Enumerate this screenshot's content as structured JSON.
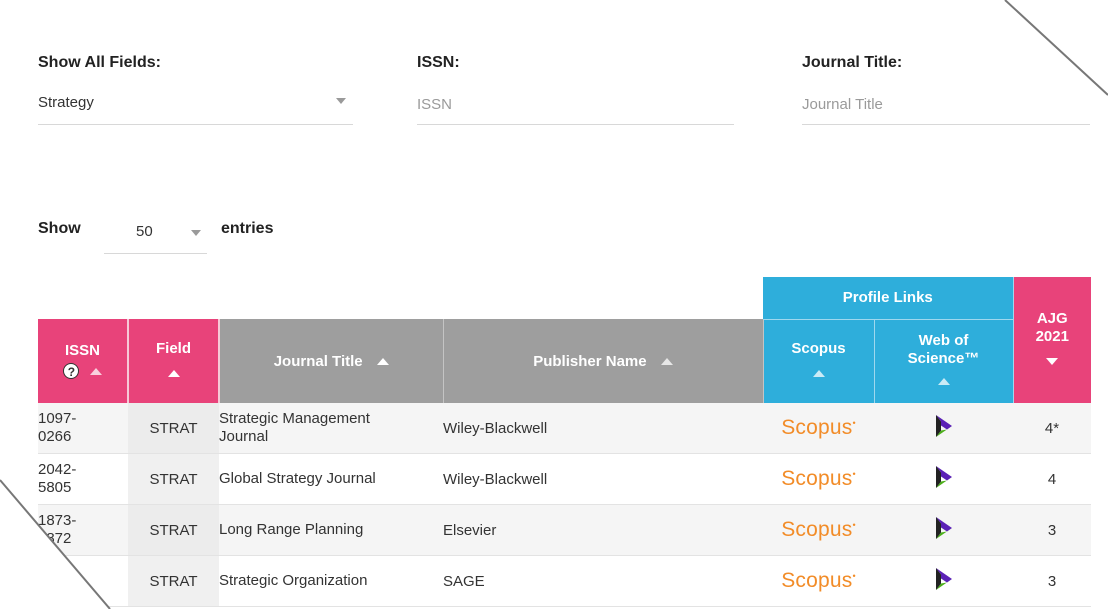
{
  "filters": {
    "field": {
      "label": "Show All Fields:",
      "value": "Strategy"
    },
    "issn": {
      "label": "ISSN:",
      "placeholder": "ISSN"
    },
    "title": {
      "label": "Journal Title:",
      "placeholder": "Journal Title"
    }
  },
  "entries": {
    "show_label": "Show",
    "value": "50",
    "suffix": "entries"
  },
  "table": {
    "group_header": "Profile Links",
    "columns": {
      "issn": "ISSN",
      "field": "Field",
      "title": "Journal Title",
      "publisher": "Publisher Name",
      "scopus": "Scopus",
      "wos_line1": "Web of",
      "wos_line2": "Science™",
      "ajg_line1": "AJG",
      "ajg_line2": "2021"
    },
    "help_symbol": "?",
    "scopus_logo_text": "Scopus",
    "rows": [
      {
        "issn_a": "1097-",
        "issn_b": "0266",
        "field": "STRAT",
        "title_a": "Strategic Management",
        "title_b": "Journal",
        "publisher": "Wiley-Blackwell",
        "ajg": "4*"
      },
      {
        "issn_a": "2042-",
        "issn_b": "5805",
        "field": "STRAT",
        "title_a": "Global Strategy Journal",
        "title_b": "",
        "publisher": "Wiley-Blackwell",
        "ajg": "4"
      },
      {
        "issn_a": "1873-",
        "issn_b": "1872",
        "field": "STRAT",
        "title_a": "Long Range Planning",
        "title_b": "",
        "publisher": "Elsevier",
        "ajg": "3"
      },
      {
        "issn_a": "",
        "issn_b": "",
        "field": "STRAT",
        "title_a": "Strategic Organization",
        "title_b": "",
        "publisher": "SAGE",
        "ajg": "3"
      }
    ]
  },
  "colors": {
    "pink": "#e8437a",
    "blue": "#2eaedb",
    "grey": "#9e9e9e",
    "scopus_orange": "#f28c28",
    "wos_purple": "#5b21b6",
    "wos_green": "#4caf1a"
  },
  "icons": {
    "help": "question-circle-icon",
    "sort_up": "sort-asc-icon",
    "sort_down": "sort-desc-icon",
    "dropdown": "caret-down-icon",
    "wos": "clarivate-logo-icon"
  }
}
